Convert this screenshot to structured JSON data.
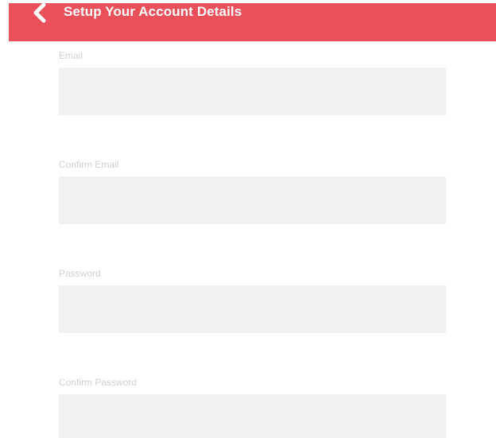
{
  "header": {
    "title": "Setup Your Account Details",
    "background_color": "#e9505a",
    "back_icon": "chevron-left-icon"
  },
  "form": {
    "email": {
      "label": "Email",
      "value": ""
    },
    "confirm_email": {
      "label": "Confirm Email",
      "value": ""
    },
    "password": {
      "label": "Password",
      "value": ""
    },
    "confirm_password": {
      "label": "Confirm Password",
      "value": ""
    }
  }
}
